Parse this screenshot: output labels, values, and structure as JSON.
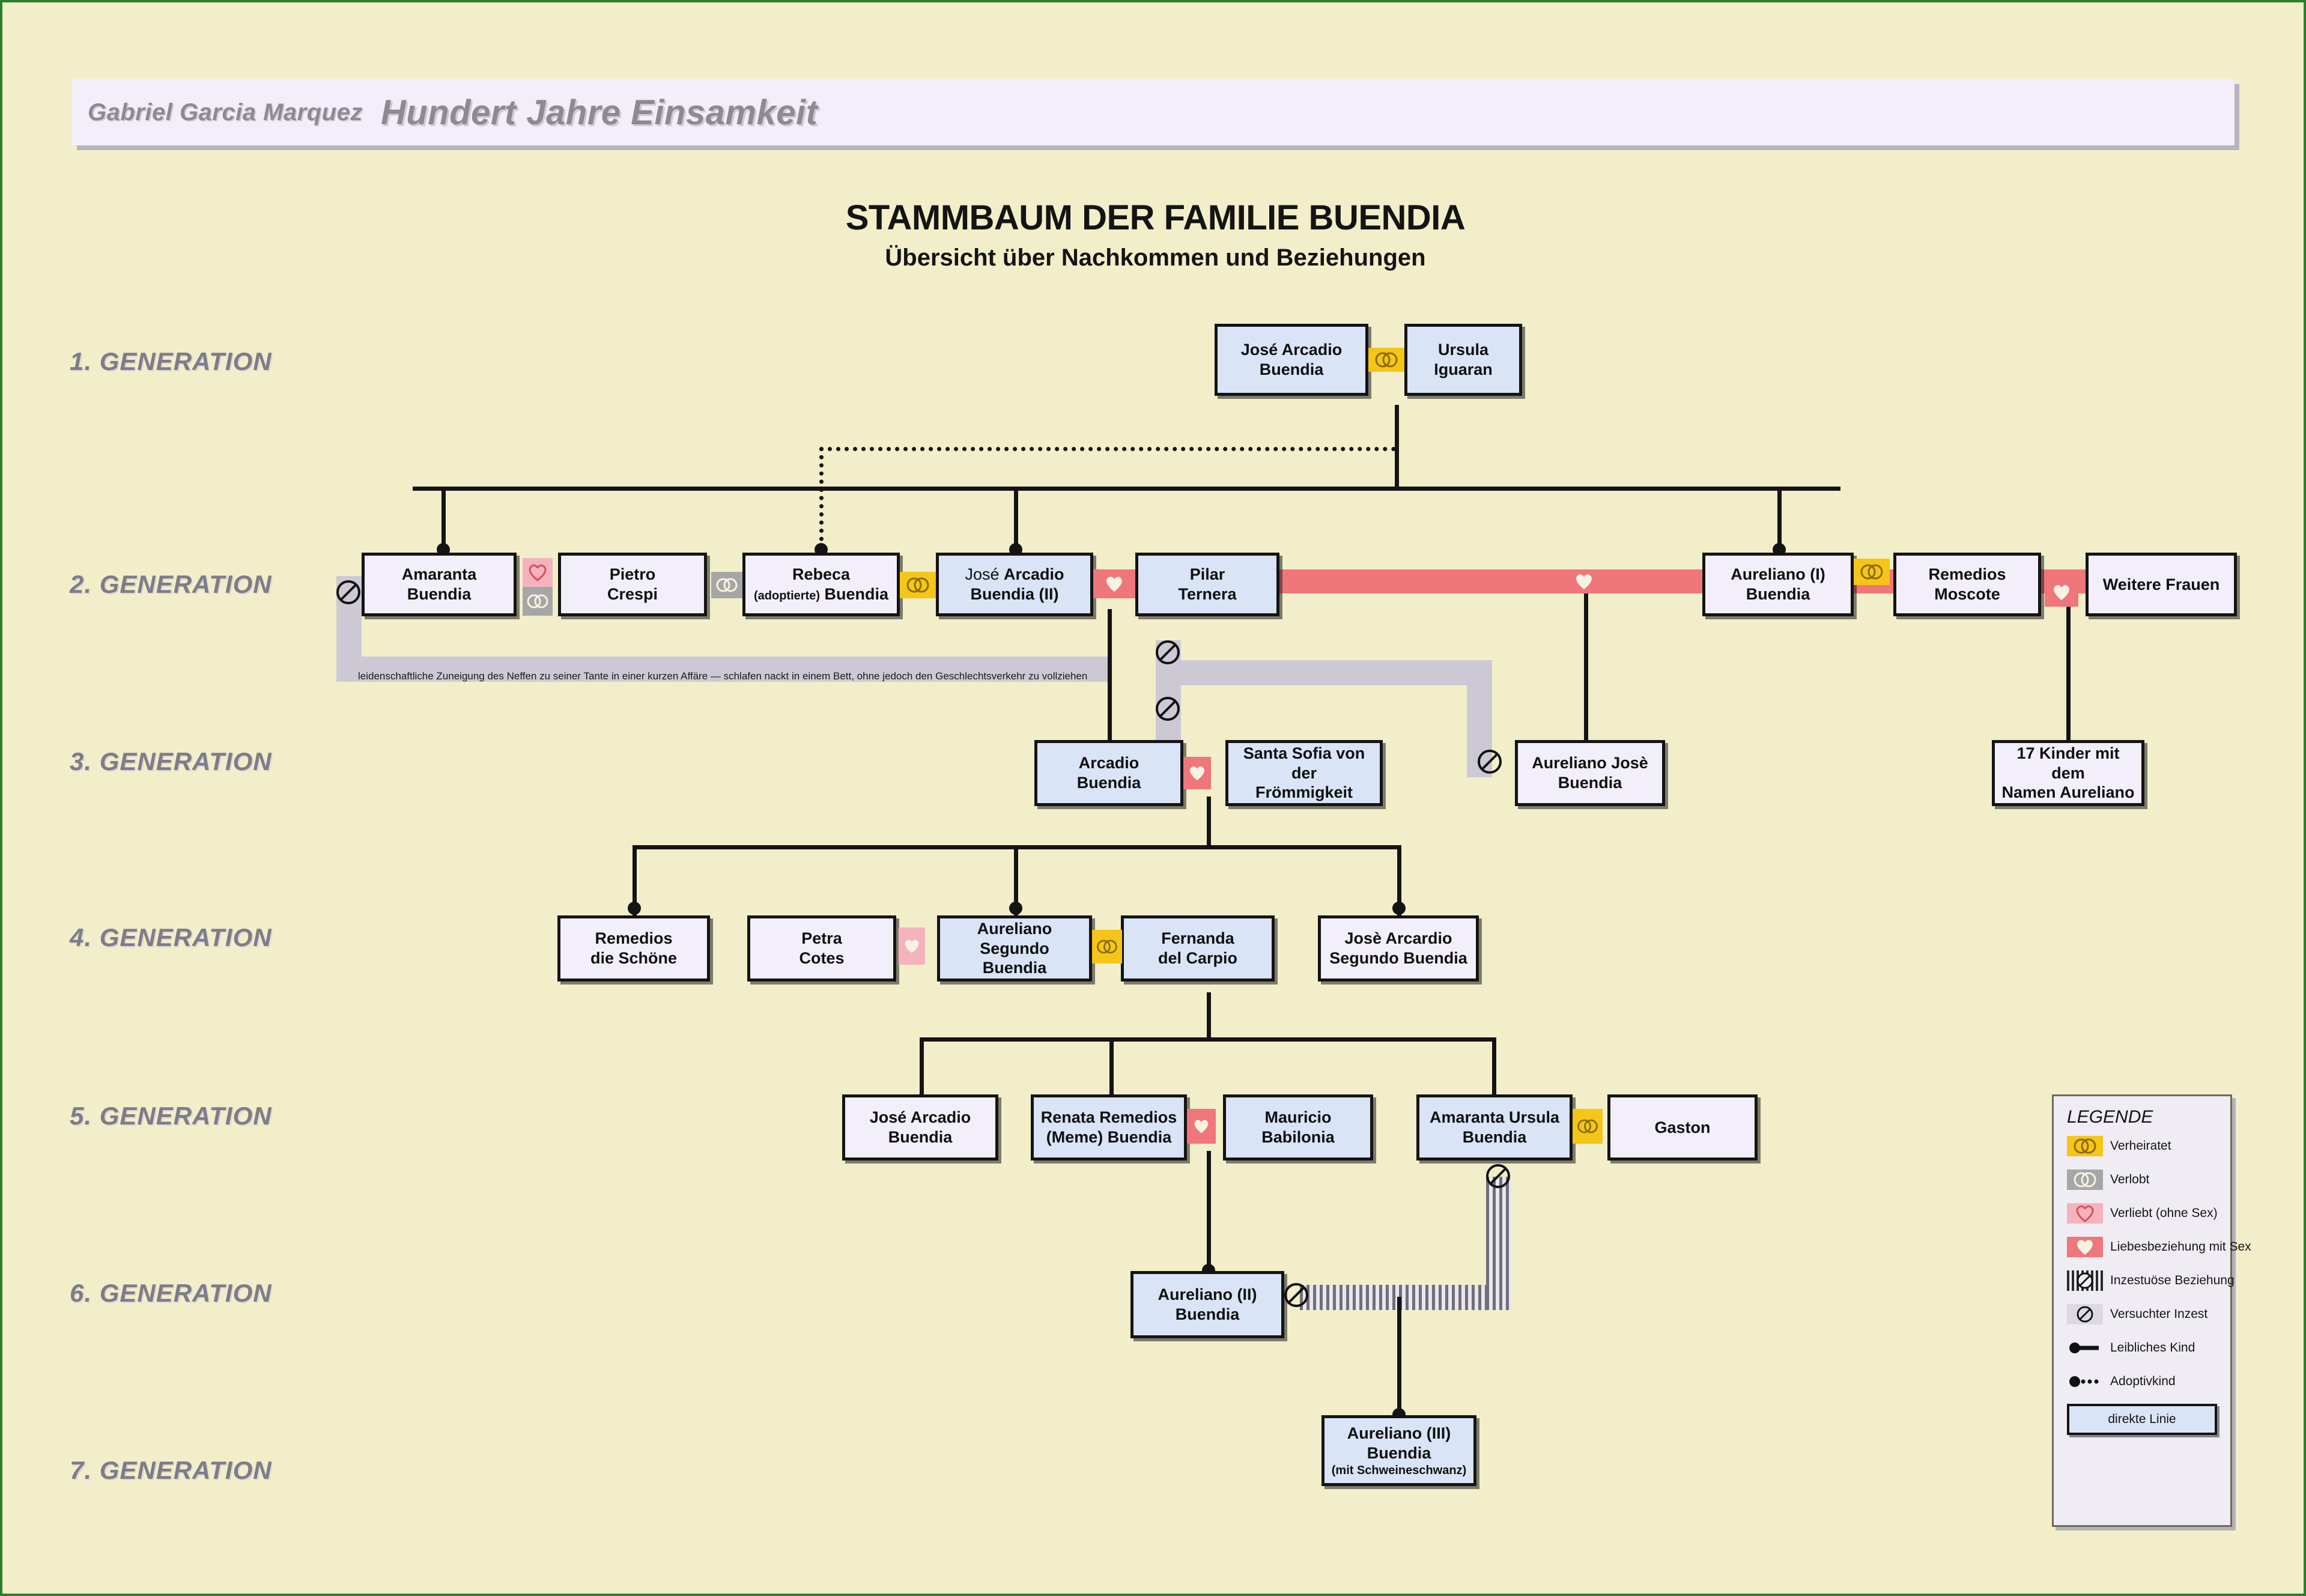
{
  "header": {
    "author": "Gabriel Garcia Marquez",
    "book_title": "Hundert Jahre Einsamkeit"
  },
  "titles": {
    "main": "STAMMBAUM DER FAMILIE BUENDIA",
    "subtitle": "Übersicht über Nachkommen und Beziehungen"
  },
  "generations": [
    {
      "label": "1. GENERATION"
    },
    {
      "label": "2. GENERATION"
    },
    {
      "label": "3. GENERATION"
    },
    {
      "label": "4. GENERATION"
    },
    {
      "label": "5. GENERATION"
    },
    {
      "label": "6. GENERATION"
    },
    {
      "label": "7. GENERATION"
    }
  ],
  "people": {
    "jose_arcadio_buendia": {
      "line1": "José Arcadio",
      "line2": "Buendia"
    },
    "ursula_iguaran": {
      "line1": "Ursula",
      "line2": "Iguaran"
    },
    "amaranta": {
      "line1": "Amaranta",
      "line2": "Buendia"
    },
    "pietro_crespi": {
      "line1": "Pietro",
      "line2": "Crespi"
    },
    "rebeca": {
      "line1": "Rebeca",
      "line2_small": "(adoptierte)",
      "line2_bold": "Buendia"
    },
    "jose_arcadio_ii": {
      "line1_reg": "José ",
      "line1_bold": "Arcadio",
      "line2": "Buendia (II)"
    },
    "pilar_ternera": {
      "line1": "Pilar",
      "line2": "Ternera"
    },
    "aureliano_i": {
      "line1": "Aureliano (I)",
      "line2": "Buendia"
    },
    "remedios_moscote": {
      "line1": "Remedios",
      "line2": "Moscote"
    },
    "weitere_frauen": {
      "line1": "Weitere Frauen"
    },
    "arcadio": {
      "line1": "Arcadio",
      "line2": "Buendia"
    },
    "santa_sofia": {
      "line1": "Santa Sofia von der",
      "line2": "Frömmigkeit"
    },
    "aureliano_jose": {
      "line1": "Aureliano Josè",
      "line2": "Buendia"
    },
    "kinder17": {
      "line1": "17 Kinder mit dem",
      "line2": "Namen Aureliano"
    },
    "remedios_schoene": {
      "line1": "Remedios",
      "line2": "die Schöne"
    },
    "petra_cotes": {
      "line1": "Petra",
      "line2": "Cotes"
    },
    "aureliano_segundo": {
      "line1": "Aureliano Segundo",
      "line2": "Buendia"
    },
    "fernanda": {
      "line1": "Fernanda",
      "line2": "del Carpio"
    },
    "jose_arcadio_segundo": {
      "line1": "Josè Arcardio",
      "line2": "Segundo Buendia"
    },
    "jose_arcadio_g5": {
      "line1": "José Arcadio",
      "line2": "Buendia"
    },
    "meme": {
      "line1": "Renata Remedios",
      "line2": "(Meme) Buendia"
    },
    "mauricio": {
      "line1": "Mauricio",
      "line2": "Babilonia"
    },
    "amaranta_ursula": {
      "line1": "Amaranta Ursula",
      "line2": "Buendia"
    },
    "gaston": {
      "line1": "Gaston"
    },
    "aureliano_ii": {
      "line1": "Aureliano (II)",
      "line2": "Buendia"
    },
    "aureliano_iii": {
      "line1": "Aureliano (III)",
      "line2": "Buendia",
      "line3": "(mit Schweineschwanz)"
    }
  },
  "annotations": {
    "amaranta_note": "leidenschaftliche Zuneigung des Neffen zu seiner Tante  in einer kurzen Affäre — schlafen nackt in einem Bett, ohne jedoch den Geschlechtsverkehr zu vollziehen"
  },
  "legend": {
    "title": "LEGENDE",
    "items": [
      {
        "key": "married-icon",
        "label": "Verheiratet"
      },
      {
        "key": "engaged-icon",
        "label": "Verlobt"
      },
      {
        "key": "love-no-sex-icon",
        "label": "Verliebt (ohne Sex)"
      },
      {
        "key": "love-sex-icon",
        "label": "Liebesbeziehung mit Sex"
      },
      {
        "key": "incest-icon",
        "label": "Inzestuöse Beziehung"
      },
      {
        "key": "attempted-incest-icon",
        "label": "Versuchter Inzest"
      },
      {
        "key": "biological-child-icon",
        "label": "Leibliches Kind"
      },
      {
        "key": "adopted-child-icon",
        "label": "Adoptivkind"
      }
    ],
    "box_label": "direkte Linie"
  },
  "colors": {
    "background": "#f2eec9",
    "box_blue": "#d9e4f7",
    "box_pale": "#f3effa",
    "married": "#f5c518",
    "engaged": "#a6a6a6",
    "love_no_sex": "#f4b3bc",
    "love_sex": "#ef767a",
    "grey_band": "#cdc9d4",
    "border": "#141414"
  }
}
